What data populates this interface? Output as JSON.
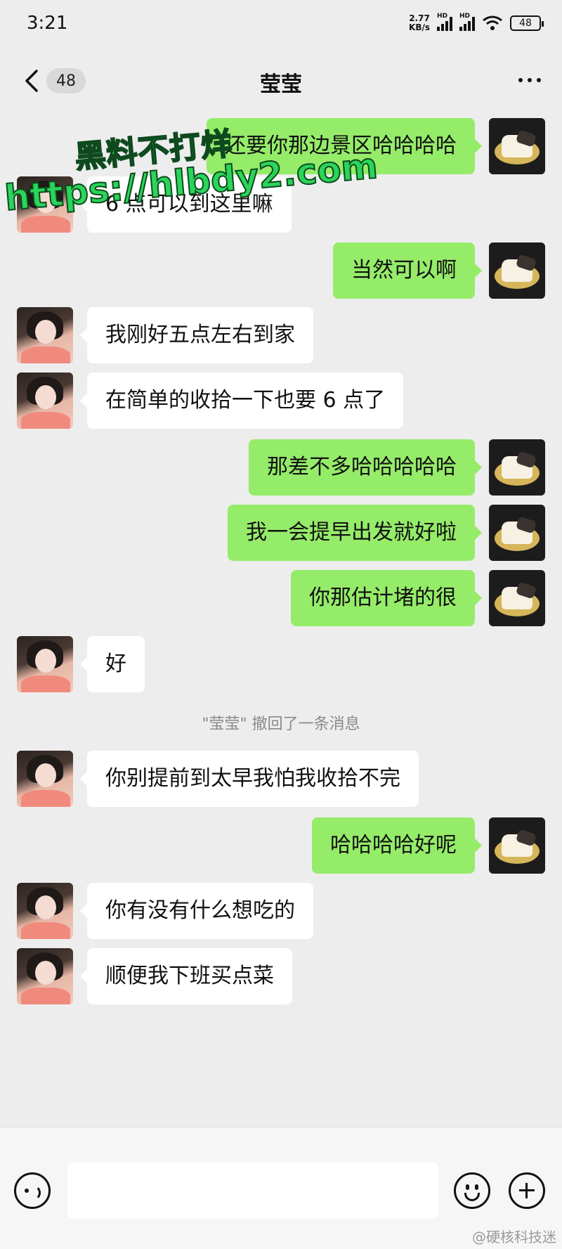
{
  "status_bar": {
    "time": "3:21",
    "net_speed": "2.77",
    "net_unit": "KB/s",
    "hd1": "HD",
    "hd2": "HD",
    "battery": "48"
  },
  "nav": {
    "unread_count": "48",
    "title": "莹莹"
  },
  "watermark": {
    "line1": "黑料不打烊",
    "line2": "https://hlbdy2.com"
  },
  "messages": [
    {
      "side": "right",
      "text": "还要你那边景区哈哈哈哈"
    },
    {
      "side": "left",
      "text": "6 点可以到这里嘛"
    },
    {
      "side": "right",
      "text": "当然可以啊"
    },
    {
      "side": "left",
      "text": "我刚好五点左右到家"
    },
    {
      "side": "left",
      "text": "在简单的收拾一下也要 6 点了"
    },
    {
      "side": "right",
      "text": "那差不多哈哈哈哈哈"
    },
    {
      "side": "right",
      "text": "我一会提早出发就好啦"
    },
    {
      "side": "right",
      "text": "你那估计堵的很"
    },
    {
      "side": "left",
      "text": "好"
    },
    {
      "side": "left",
      "text": "你别提前到太早我怕我收拾不完"
    },
    {
      "side": "right",
      "text": "哈哈哈哈好呢"
    },
    {
      "side": "left",
      "text": "你有没有什么想吃的"
    },
    {
      "side": "left",
      "text": "顺便我下班买点菜"
    }
  ],
  "system_notice": "\"莹莹\" 撤回了一条消息",
  "input": {
    "placeholder": ""
  },
  "credit": "@硬核科技迷",
  "colors": {
    "sent_bubble": "#95ec69",
    "received_bubble": "#ffffff",
    "background": "#ededed"
  }
}
